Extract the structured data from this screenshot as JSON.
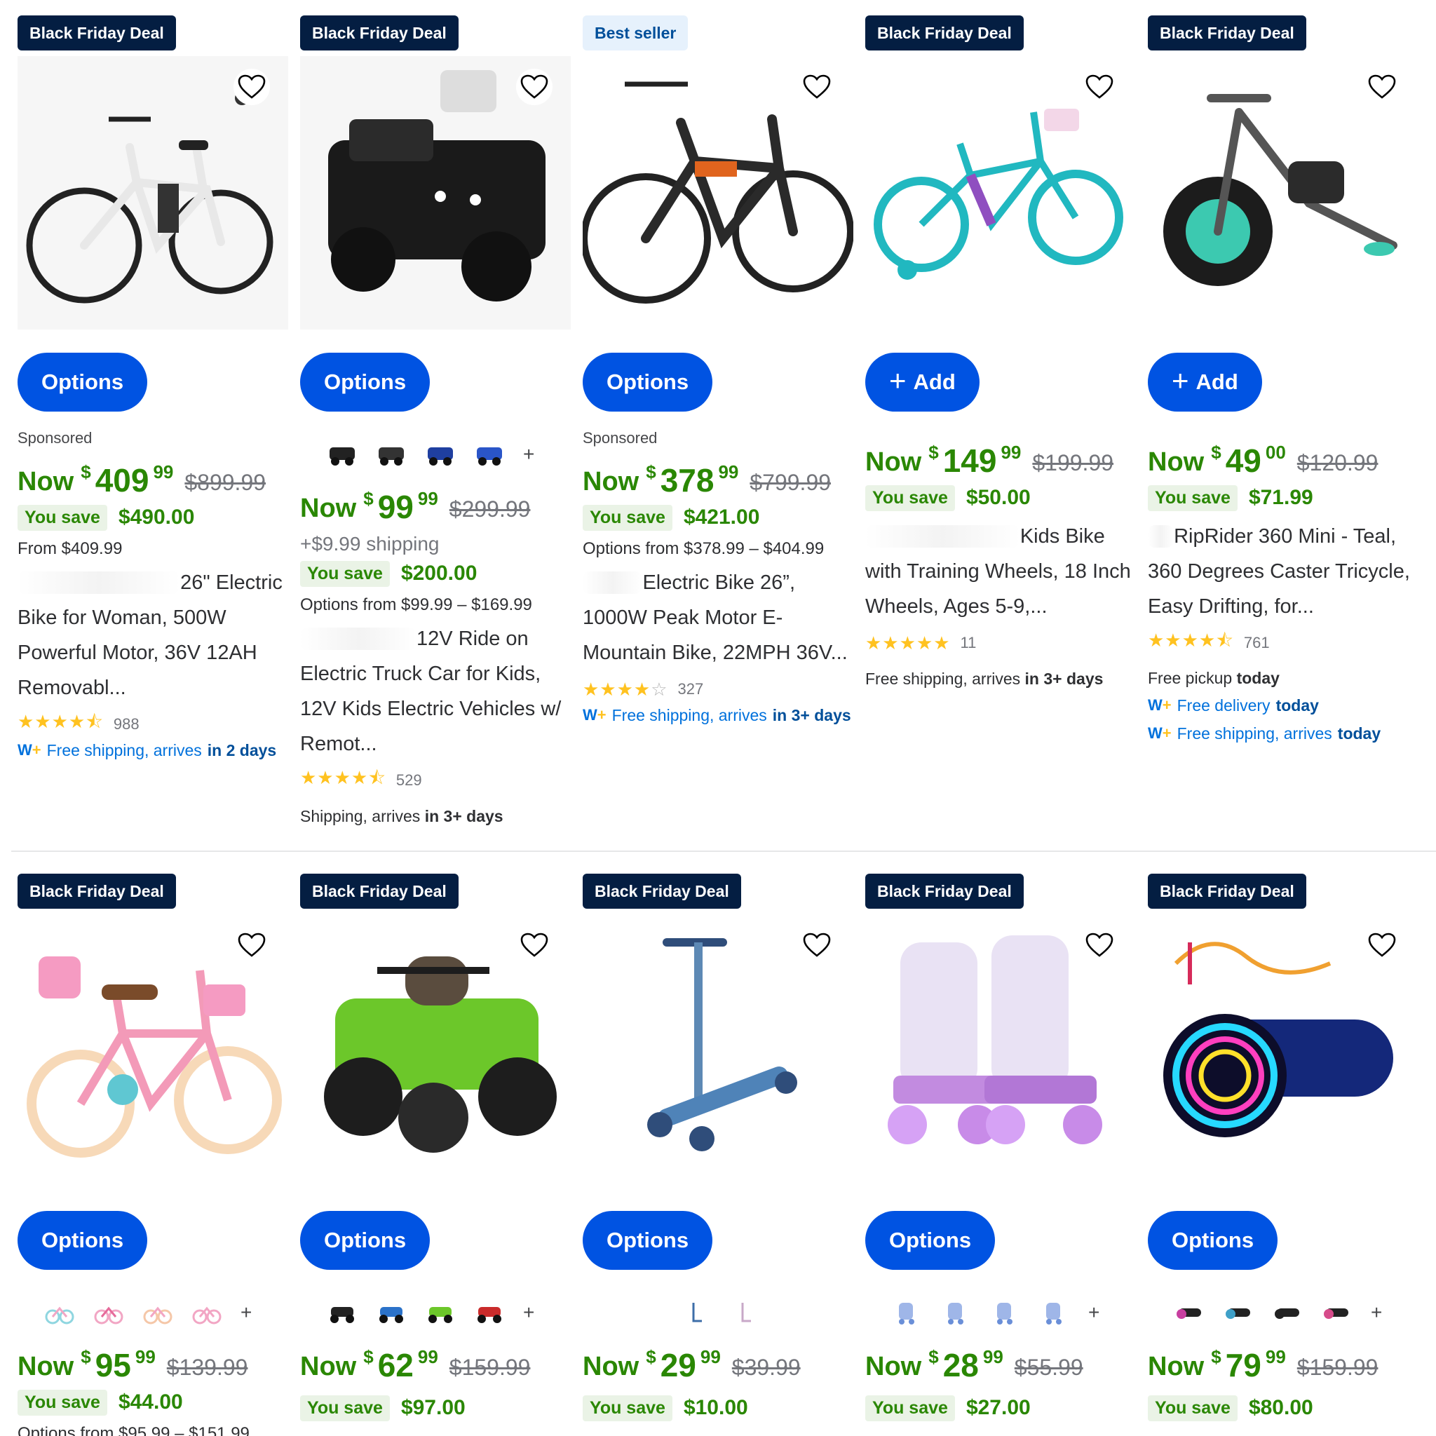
{
  "colors": {
    "brand_blue": "#0053e2",
    "deal_navy": "#041e42",
    "price_green": "#2a8703",
    "star_yellow": "#ffc220",
    "link_blue": "#0071dc"
  },
  "common": {
    "now_label": "Now",
    "currency": "$",
    "you_save_label": "You save",
    "more_swatches": "+"
  },
  "products": [
    {
      "badge": "Black Friday Deal",
      "button": "Options",
      "sponsored": "Sponsored",
      "price_dollars": "409",
      "price_cents": "99",
      "was": "$899.99",
      "save": "$490.00",
      "range": "From $409.99",
      "title": "26\" Electric Bike for Woman, 500W Powerful Motor, 36V 12AH Removabl...",
      "rating": 4.5,
      "stars": "★★★★⯪",
      "reviews": "988",
      "shipping_prefix": "Free shipping, arrives",
      "shipping_bold": "in 2 days",
      "wplus": "W+"
    },
    {
      "badge": "Black Friday Deal",
      "button": "Options",
      "swatch_icons": [
        "black-ride-on-car-swatch",
        "black-ride-on-car-swatch-2",
        "blue-ride-on-car-swatch",
        "blue-ride-on-car-swatch-2"
      ],
      "price_dollars": "99",
      "price_cents": "99",
      "was": "$299.99",
      "shipping_fee": "+$9.99 shipping",
      "save": "$200.00",
      "range": "Options from $99.99 – $169.99",
      "title": "12V Ride on Electric Truck Car for Kids, 12V Kids Electric Vehicles w/ Remot...",
      "rating": 4.5,
      "stars": "★★★★⯪",
      "reviews": "529",
      "shipping_prefix": "Shipping, arrives",
      "shipping_bold": "in 3+ days"
    },
    {
      "badge": "Best seller",
      "button": "Options",
      "sponsored": "Sponsored",
      "price_dollars": "378",
      "price_cents": "99",
      "was": "$799.99",
      "save": "$421.00",
      "range": "Options from $378.99 – $404.99",
      "title": "Electric Bike 26”, 1000W Peak Motor E-Mountain Bike, 22MPH 36V...",
      "rating": 4,
      "stars": "★★★★",
      "stars_off": "☆",
      "reviews": "327",
      "shipping_prefix": "Free shipping, arrives",
      "shipping_bold": "in 3+ days",
      "wplus": "W+"
    },
    {
      "badge": "Black Friday Deal",
      "button": "Add",
      "price_dollars": "149",
      "price_cents": "99",
      "was": "$199.99",
      "save": "$50.00",
      "title": "Kids Bike with Training Wheels, 18 Inch Wheels, Ages 5-9,...",
      "rating": 5,
      "stars": "★★★★★",
      "reviews": "11",
      "shipping_prefix": "Free shipping, arrives",
      "shipping_bold": "in 3+ days"
    },
    {
      "badge": "Black Friday Deal",
      "button": "Add",
      "price_dollars": "49",
      "price_cents": "00",
      "was": "$120.99",
      "save": "$71.99",
      "title": "RipRider 360 Mini - Teal, 360 Degrees Caster Tricycle, Easy Drifting, for...",
      "rating": 4.5,
      "stars": "★★★★⯪",
      "reviews": "761",
      "pickup_prefix": "Free pickup",
      "pickup_bold": "today",
      "delivery_prefix": "Free delivery",
      "delivery_bold": "today",
      "shipping_prefix": "Free shipping, arrives",
      "shipping_bold": "today",
      "wplus": "W+"
    },
    {
      "badge": "Black Friday Deal",
      "button": "Options",
      "swatch_icons": [
        "pink-bike-swatch",
        "pink-bike-swatch-2",
        "pink-bike-swatch-3",
        "pink-bike-swatch-4"
      ],
      "price_dollars": "95",
      "price_cents": "99",
      "was": "$139.99",
      "save": "$44.00",
      "range": "Options from $95.99 – $151.99"
    },
    {
      "badge": "Black Friday Deal",
      "button": "Options",
      "swatch_icons": [
        "black-atv-swatch",
        "blue-atv-swatch",
        "green-atv-swatch",
        "red-atv-swatch"
      ],
      "price_dollars": "62",
      "price_cents": "99",
      "was": "$159.99",
      "save": "$97.00"
    },
    {
      "badge": "Black Friday Deal",
      "button": "Options",
      "swatch_icons": [
        "blue-scooter-swatch",
        "pink-scooter-swatch"
      ],
      "price_dollars": "29",
      "price_cents": "99",
      "was": "$39.99",
      "save": "$10.00"
    },
    {
      "badge": "Black Friday Deal",
      "button": "Options",
      "swatch_icons": [
        "skate-swatch",
        "skate-swatch-2",
        "skate-swatch-3",
        "skate-swatch-4"
      ],
      "price_dollars": "28",
      "price_cents": "99",
      "was": "$55.99",
      "save": "$27.00"
    },
    {
      "badge": "Black Friday Deal",
      "button": "Options",
      "swatch_icons": [
        "hoverboard-swatch",
        "hoverboard-swatch-2",
        "hoverboard-swatch-3",
        "hoverboard-swatch-4"
      ],
      "price_dollars": "79",
      "price_cents": "99",
      "was": "$159.99",
      "save": "$80.00"
    }
  ]
}
